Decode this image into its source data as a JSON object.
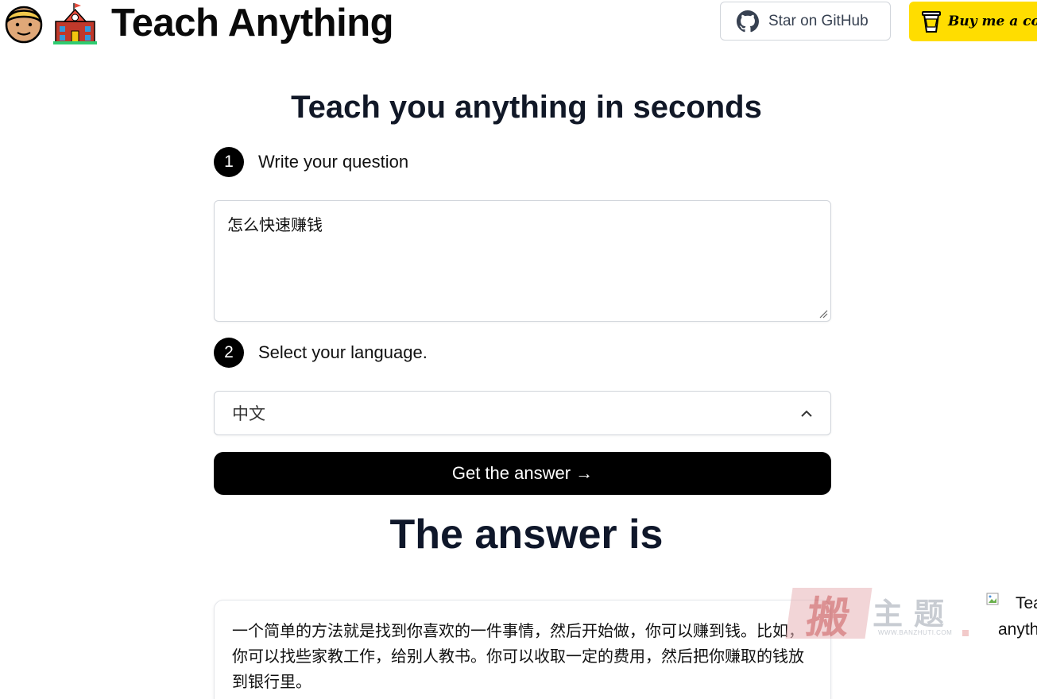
{
  "header": {
    "brand": "Teach Anything",
    "logo_icons": [
      "boy-emoji-icon",
      "school-emoji-icon"
    ],
    "github_button": "Star on GitHub",
    "coffee_button": "Buy me a coffee",
    "coffee_color": "#ffdd00"
  },
  "main": {
    "title": "Teach you anything in seconds",
    "step1": {
      "number": "1",
      "label": "Write your question"
    },
    "question_value": "怎么快速赚钱",
    "step2": {
      "number": "2",
      "label": "Select your language."
    },
    "language_selected": "中文",
    "submit_button": "Get the answer →",
    "answer_title": "The answer is",
    "answer_text": "一个简单的方法就是找到你喜欢的一件事情，然后开始做，你可以赚到钱。比如，你可以找些家教工作，给别人教书。你可以收取一定的费用，然后把你赚取的钱放到银行里。"
  },
  "watermark": {
    "big_char": "搬",
    "small_chars": "主题",
    "url": "WWW.BANZHUTI.COM"
  },
  "broken_image": {
    "alt_line1": "Tea",
    "alt_line2": "anyth"
  }
}
